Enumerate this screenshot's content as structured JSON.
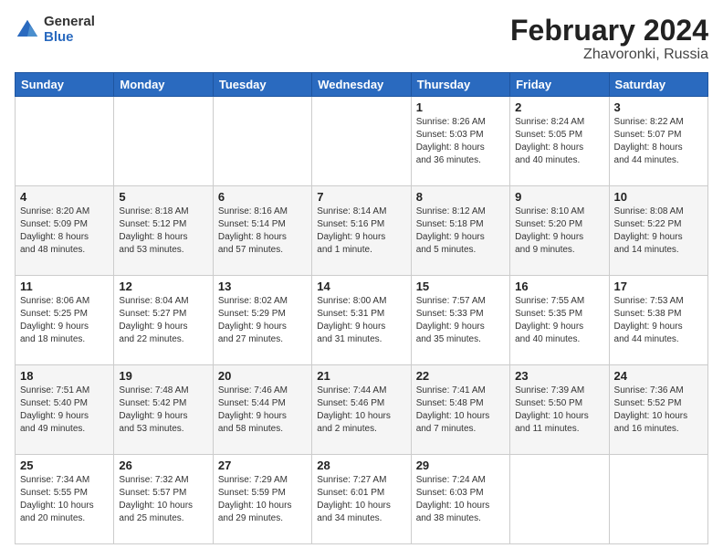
{
  "logo": {
    "general": "General",
    "blue": "Blue"
  },
  "title": {
    "month_year": "February 2024",
    "location": "Zhavoronki, Russia"
  },
  "days_of_week": [
    "Sunday",
    "Monday",
    "Tuesday",
    "Wednesday",
    "Thursday",
    "Friday",
    "Saturday"
  ],
  "weeks": [
    [
      {
        "day": "",
        "info": ""
      },
      {
        "day": "",
        "info": ""
      },
      {
        "day": "",
        "info": ""
      },
      {
        "day": "",
        "info": ""
      },
      {
        "day": "1",
        "info": "Sunrise: 8:26 AM\nSunset: 5:03 PM\nDaylight: 8 hours\nand 36 minutes."
      },
      {
        "day": "2",
        "info": "Sunrise: 8:24 AM\nSunset: 5:05 PM\nDaylight: 8 hours\nand 40 minutes."
      },
      {
        "day": "3",
        "info": "Sunrise: 8:22 AM\nSunset: 5:07 PM\nDaylight: 8 hours\nand 44 minutes."
      }
    ],
    [
      {
        "day": "4",
        "info": "Sunrise: 8:20 AM\nSunset: 5:09 PM\nDaylight: 8 hours\nand 48 minutes."
      },
      {
        "day": "5",
        "info": "Sunrise: 8:18 AM\nSunset: 5:12 PM\nDaylight: 8 hours\nand 53 minutes."
      },
      {
        "day": "6",
        "info": "Sunrise: 8:16 AM\nSunset: 5:14 PM\nDaylight: 8 hours\nand 57 minutes."
      },
      {
        "day": "7",
        "info": "Sunrise: 8:14 AM\nSunset: 5:16 PM\nDaylight: 9 hours\nand 1 minute."
      },
      {
        "day": "8",
        "info": "Sunrise: 8:12 AM\nSunset: 5:18 PM\nDaylight: 9 hours\nand 5 minutes."
      },
      {
        "day": "9",
        "info": "Sunrise: 8:10 AM\nSunset: 5:20 PM\nDaylight: 9 hours\nand 9 minutes."
      },
      {
        "day": "10",
        "info": "Sunrise: 8:08 AM\nSunset: 5:22 PM\nDaylight: 9 hours\nand 14 minutes."
      }
    ],
    [
      {
        "day": "11",
        "info": "Sunrise: 8:06 AM\nSunset: 5:25 PM\nDaylight: 9 hours\nand 18 minutes."
      },
      {
        "day": "12",
        "info": "Sunrise: 8:04 AM\nSunset: 5:27 PM\nDaylight: 9 hours\nand 22 minutes."
      },
      {
        "day": "13",
        "info": "Sunrise: 8:02 AM\nSunset: 5:29 PM\nDaylight: 9 hours\nand 27 minutes."
      },
      {
        "day": "14",
        "info": "Sunrise: 8:00 AM\nSunset: 5:31 PM\nDaylight: 9 hours\nand 31 minutes."
      },
      {
        "day": "15",
        "info": "Sunrise: 7:57 AM\nSunset: 5:33 PM\nDaylight: 9 hours\nand 35 minutes."
      },
      {
        "day": "16",
        "info": "Sunrise: 7:55 AM\nSunset: 5:35 PM\nDaylight: 9 hours\nand 40 minutes."
      },
      {
        "day": "17",
        "info": "Sunrise: 7:53 AM\nSunset: 5:38 PM\nDaylight: 9 hours\nand 44 minutes."
      }
    ],
    [
      {
        "day": "18",
        "info": "Sunrise: 7:51 AM\nSunset: 5:40 PM\nDaylight: 9 hours\nand 49 minutes."
      },
      {
        "day": "19",
        "info": "Sunrise: 7:48 AM\nSunset: 5:42 PM\nDaylight: 9 hours\nand 53 minutes."
      },
      {
        "day": "20",
        "info": "Sunrise: 7:46 AM\nSunset: 5:44 PM\nDaylight: 9 hours\nand 58 minutes."
      },
      {
        "day": "21",
        "info": "Sunrise: 7:44 AM\nSunset: 5:46 PM\nDaylight: 10 hours\nand 2 minutes."
      },
      {
        "day": "22",
        "info": "Sunrise: 7:41 AM\nSunset: 5:48 PM\nDaylight: 10 hours\nand 7 minutes."
      },
      {
        "day": "23",
        "info": "Sunrise: 7:39 AM\nSunset: 5:50 PM\nDaylight: 10 hours\nand 11 minutes."
      },
      {
        "day": "24",
        "info": "Sunrise: 7:36 AM\nSunset: 5:52 PM\nDaylight: 10 hours\nand 16 minutes."
      }
    ],
    [
      {
        "day": "25",
        "info": "Sunrise: 7:34 AM\nSunset: 5:55 PM\nDaylight: 10 hours\nand 20 minutes."
      },
      {
        "day": "26",
        "info": "Sunrise: 7:32 AM\nSunset: 5:57 PM\nDaylight: 10 hours\nand 25 minutes."
      },
      {
        "day": "27",
        "info": "Sunrise: 7:29 AM\nSunset: 5:59 PM\nDaylight: 10 hours\nand 29 minutes."
      },
      {
        "day": "28",
        "info": "Sunrise: 7:27 AM\nSunset: 6:01 PM\nDaylight: 10 hours\nand 34 minutes."
      },
      {
        "day": "29",
        "info": "Sunrise: 7:24 AM\nSunset: 6:03 PM\nDaylight: 10 hours\nand 38 minutes."
      },
      {
        "day": "",
        "info": ""
      },
      {
        "day": "",
        "info": ""
      }
    ]
  ]
}
